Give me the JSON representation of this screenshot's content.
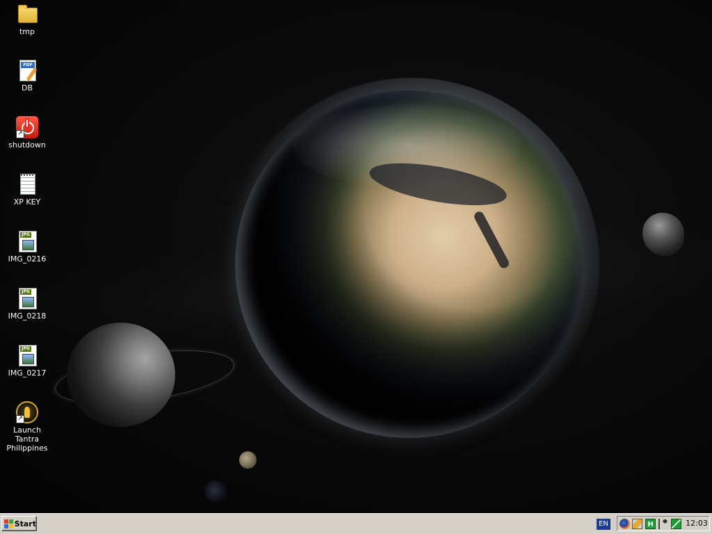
{
  "desktop": {
    "icons": [
      {
        "label": "tmp",
        "icon": "folder-icon"
      },
      {
        "label": "DB",
        "icon": "pdf-document-icon"
      },
      {
        "label": "shutdown",
        "icon": "shutdown-icon"
      },
      {
        "label": "XP KEY",
        "icon": "text-document-icon"
      },
      {
        "label": "IMG_0216",
        "icon": "jpg-image-icon"
      },
      {
        "label": "IMG_0218",
        "icon": "jpg-image-icon"
      },
      {
        "label": "IMG_0217",
        "icon": "jpg-image-icon"
      },
      {
        "label": "Launch Tantra Philippines",
        "icon": "tantra-game-icon"
      }
    ],
    "wallpaper": "space-earth-wallpaper"
  },
  "taskbar": {
    "start_label": "Start",
    "language": "EN",
    "tray_icons": [
      "firefox-icon",
      "pencil-icon",
      "green-h-icon",
      "person-icon",
      "sync-arrows-icon"
    ],
    "clock": "12:03"
  },
  "colors": {
    "taskbar_bg": "#d4d0c8",
    "desktop_bg": "#050505",
    "language_bg": "#1c3c8c"
  }
}
